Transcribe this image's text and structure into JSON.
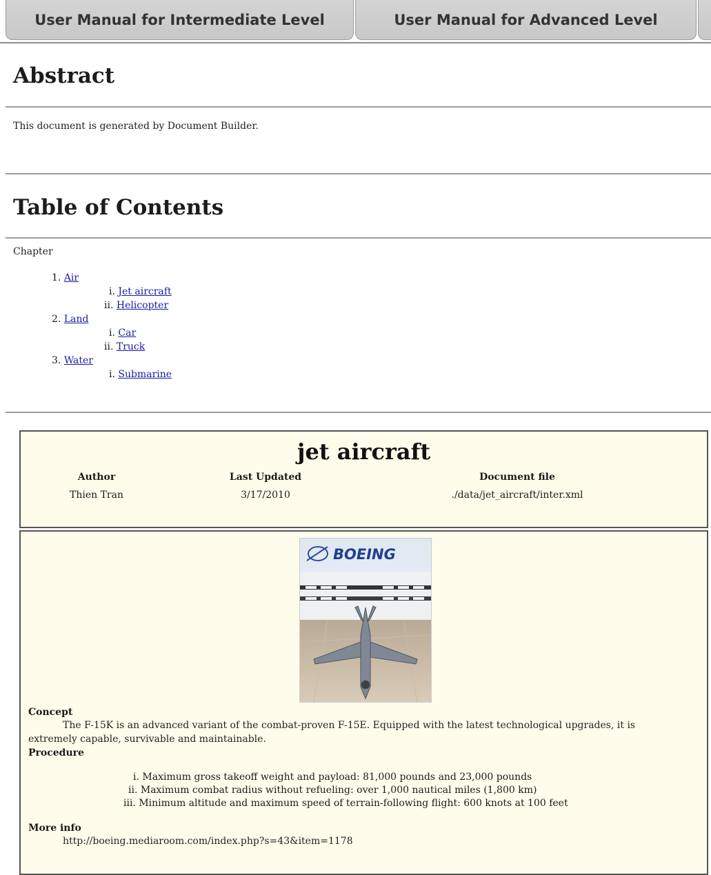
{
  "tabs": [
    "User Manual for Intermediate Level",
    "User Manual for Advanced Level"
  ],
  "abstract": {
    "heading": "Abstract",
    "text": "This document is generated by Document Builder."
  },
  "toc": {
    "heading": "Table of Contents",
    "chapter_label": "Chapter",
    "chapters": [
      {
        "num": "1.",
        "label": "Air",
        "subs": [
          {
            "num": "i.",
            "label": "Jet aircraft"
          },
          {
            "num": "ii.",
            "label": "Helicopter"
          }
        ]
      },
      {
        "num": "2.",
        "label": "Land",
        "subs": [
          {
            "num": "i.",
            "label": "Car"
          },
          {
            "num": "ii.",
            "label": "Truck"
          }
        ]
      },
      {
        "num": "3.",
        "label": "Water",
        "subs": [
          {
            "num": "i.",
            "label": "Submarine"
          }
        ]
      }
    ]
  },
  "article": {
    "title": "jet aircraft",
    "meta": {
      "author_label": "Author",
      "author": "Thien Tran",
      "updated_label": "Last Updated",
      "updated": "3/17/2010",
      "file_label": "Document file",
      "file": "./data/jet_aircraft/inter.xml"
    },
    "image": {
      "logo_text": "BOEING"
    },
    "concept_label": "Concept",
    "concept_text_line1": "The F-15K is an advanced variant of the combat-proven F-15E. Equipped with the latest technological upgrades, it is",
    "concept_text_line2": "extremely capable, survivable and maintainable.",
    "procedure_label": "Procedure",
    "procedure": [
      {
        "num": "i.",
        "text": "Maximum gross takeoff weight and payload: 81,000 pounds and 23,000 pounds"
      },
      {
        "num": "ii.",
        "text": "Maximum combat radius without refueling: over 1,000 nautical miles (1,800 km)"
      },
      {
        "num": "iii.",
        "text": "Minimum altitude and maximum speed of terrain-following flight: 600 knots at 100 feet"
      }
    ],
    "more_label": "More info",
    "more_text": "http://boeing.mediaroom.com/index.php?s=43&item=1178"
  }
}
